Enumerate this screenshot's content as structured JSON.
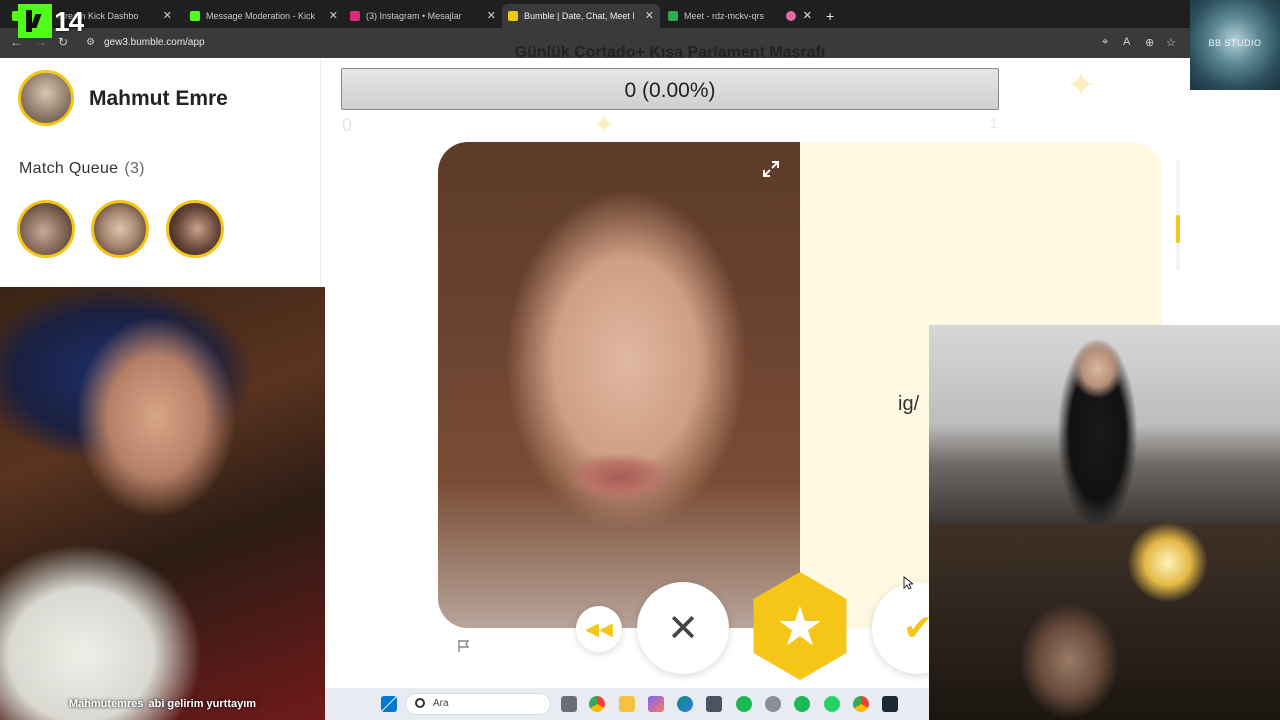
{
  "browser": {
    "tabs": [
      {
        "title": "stream Kick Dashboard",
        "favicon_color": "#53fc18",
        "active": false
      },
      {
        "title": "Message Moderation - Kick Da",
        "favicon_color": "#53fc18",
        "active": false
      },
      {
        "title": "(3) Instagram • Mesajlar",
        "favicon_color": "#d62976",
        "active": false
      },
      {
        "title": "Bumble | Date, Chat, Meet New",
        "favicon_color": "#f5c518",
        "active": true
      },
      {
        "title": "Meet - rdz-mckv-qrs",
        "favicon_color": "#34a853",
        "active": false
      },
      {
        "title": "",
        "favicon_color": "#e06c9f",
        "active": false
      }
    ],
    "new_tab_label": "+",
    "url": "gew3.bumble.com/app",
    "icons": [
      "back-icon",
      "forward-icon",
      "reload-icon",
      "site-settings-icon",
      "location-icon",
      "translate-icon",
      "zoom-icon",
      "bookmark-star-icon"
    ]
  },
  "stream_overlay": {
    "logo_number": "14",
    "studio_label": "BB STUDIO",
    "goal_title": "Günlük Cortado+ Kısa Parlament Masrafı",
    "goal_progress_text": "0 (0.00%)",
    "goal_progress_fraction": 0,
    "goal_min": "0",
    "goal_max": "1"
  },
  "sidebar": {
    "user_name": "Mahmut Emre",
    "match_queue_label": "Match Queue",
    "match_queue_count": "(3)",
    "queue": [
      {
        "name": "match-1"
      },
      {
        "name": "match-2"
      },
      {
        "name": "match-3"
      }
    ]
  },
  "profile": {
    "bio_fragment": "ig/",
    "actions": {
      "rewind_icon": "rewind-icon",
      "pass_icon": "close-icon",
      "superswipe_icon": "star-icon",
      "like_icon": "check-icon"
    }
  },
  "chat_overlay": {
    "username": "Mahmutemres",
    "message": "abi gelirim yurttayım"
  },
  "taskbar": {
    "search_placeholder": "Ara"
  },
  "colors": {
    "bumble_yellow": "#f5c518",
    "chrome_dark": "#1f1f1f",
    "chrome_bar": "#3a3a3a",
    "kick_green": "#53fc18"
  }
}
